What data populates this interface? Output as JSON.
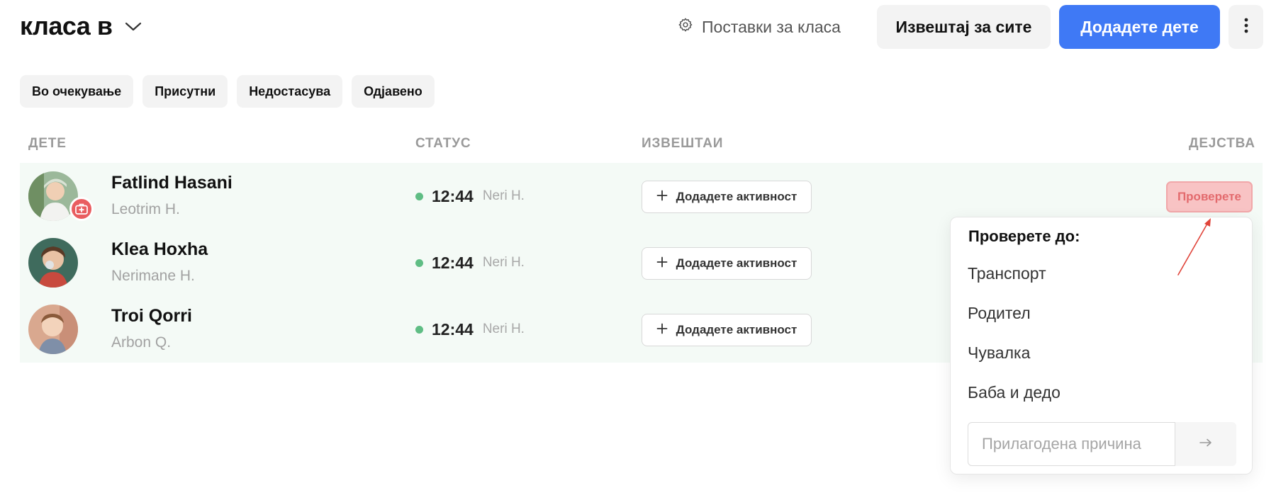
{
  "header": {
    "class_title": "класа в",
    "settings_label": "Поставки за класа",
    "report_all_label": "Извештај за сите",
    "add_child_label": "Додадете дете"
  },
  "filters": [
    "Во очекување",
    "Присутни",
    "Недостасува",
    "Одјавено"
  ],
  "columns": {
    "child": "ДЕТЕ",
    "status": "СТАТУС",
    "reports": "ИЗВЕШТАИ",
    "actions": "ДЕЈСТВА"
  },
  "rows": [
    {
      "child_name": "Fatlind Hasani",
      "parent_name": "Leotrim H.",
      "status_time": "12:44",
      "status_by": "Neri H.",
      "has_health_badge": true,
      "avatar_bg": "#9bb89a"
    },
    {
      "child_name": "Klea Hoxha",
      "parent_name": "Nerimane H.",
      "status_time": "12:44",
      "status_by": "Neri H.",
      "has_health_badge": false,
      "avatar_bg": "#3f6b5d"
    },
    {
      "child_name": "Troi Qorri",
      "parent_name": "Arbon Q.",
      "status_time": "12:44",
      "status_by": "Neri H.",
      "has_health_badge": false,
      "avatar_bg": "#d9a88f"
    }
  ],
  "row_actions": {
    "add_activity_label": "Додадете активност",
    "checkout_label": "Проверете"
  },
  "checkout_menu": {
    "title": "Проверете до:",
    "options": [
      "Транспорт",
      "Родител",
      "Чувалка",
      "Баба и дедо"
    ],
    "custom_placeholder": "Прилагодена причина",
    "custom_value": ""
  },
  "colors": {
    "accent": "#3f79f5",
    "row_bg": "#f4faf6",
    "status_dot": "#5fbd84",
    "checkout_bg": "#f8c3c4",
    "checkout_text": "#e36a6d",
    "health_badge": "#e95d60",
    "annotation": "#e0443a"
  },
  "icons": {
    "class_dropdown": "chevron-down-icon",
    "settings": "gear-icon",
    "more": "vertical-dots-icon",
    "add": "plus-icon",
    "health": "medical-kit-icon",
    "submit": "arrow-right-icon"
  }
}
